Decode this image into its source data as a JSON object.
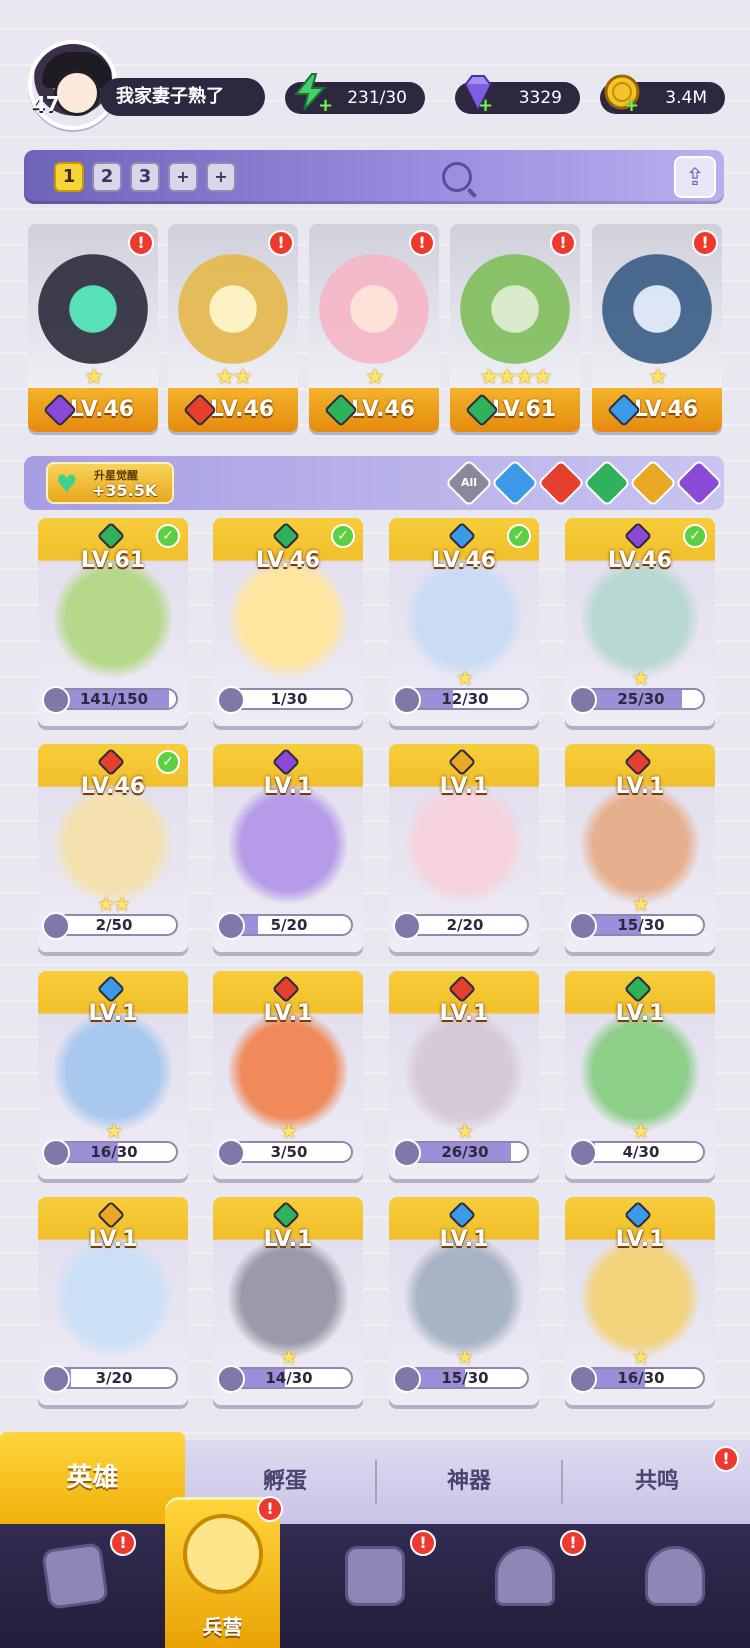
{
  "player": {
    "level": "47",
    "name": "我家妻子熟了"
  },
  "resources": [
    {
      "key": "energy",
      "value": "231/30",
      "icon": "energy-bolt-icon",
      "color": "#45d16a"
    },
    {
      "key": "gems",
      "value": "3329",
      "icon": "gem-icon",
      "color": "#a58cf4"
    },
    {
      "key": "gold",
      "value": "3.4M",
      "icon": "gold-coin-icon",
      "color": "#f2c32b"
    }
  ],
  "teams": {
    "slots": [
      "1",
      "2",
      "3",
      "+",
      "+"
    ],
    "active": "1"
  },
  "lineup": [
    {
      "level": "LV.46",
      "element": "dark",
      "stars": "★",
      "alert": "!"
    },
    {
      "level": "LV.46",
      "element": "fire",
      "stars": "★★",
      "alert": "!"
    },
    {
      "level": "LV.46",
      "element": "wind",
      "stars": "★",
      "alert": "!"
    },
    {
      "level": "LV.61",
      "element": "wind",
      "stars": "★★★★",
      "alert": "!"
    },
    {
      "level": "LV.46",
      "element": "water",
      "stars": "★",
      "alert": "!"
    }
  ],
  "awaken": {
    "label": "升星觉醒",
    "value": "+35.5K"
  },
  "filters": [
    {
      "name": "all",
      "label": "All",
      "color": "#8b879d"
    },
    {
      "name": "water",
      "label": "",
      "color": "#3b9ae8"
    },
    {
      "name": "fire",
      "label": "",
      "color": "#e5402e"
    },
    {
      "name": "wind",
      "label": "",
      "color": "#2fb25a"
    },
    {
      "name": "light",
      "label": "",
      "color": "#e8a824"
    },
    {
      "name": "dark",
      "label": "",
      "color": "#8a4ad6"
    }
  ],
  "element_colors": {
    "dark": "#8a4ad6",
    "fire": "#e5402e",
    "wind": "#2fb25a",
    "water": "#3b9ae8",
    "light": "#e8a824"
  },
  "heroes": [
    {
      "level": "LV.61",
      "element": "wind",
      "shards": "141/150",
      "progress": 0.94,
      "checked": true,
      "stars": ""
    },
    {
      "level": "LV.46",
      "element": "wind",
      "shards": "1/30",
      "progress": 0.03,
      "checked": true,
      "stars": ""
    },
    {
      "level": "LV.46",
      "element": "water",
      "shards": "12/30",
      "progress": 0.4,
      "checked": true,
      "stars": "★"
    },
    {
      "level": "LV.46",
      "element": "dark",
      "shards": "25/30",
      "progress": 0.83,
      "checked": true,
      "stars": "★"
    },
    {
      "level": "LV.46",
      "element": "fire",
      "shards": "2/50",
      "progress": 0.04,
      "checked": true,
      "stars": "★★"
    },
    {
      "level": "LV.1",
      "element": "dark",
      "shards": "5/20",
      "progress": 0.25,
      "checked": false,
      "stars": ""
    },
    {
      "level": "LV.1",
      "element": "light",
      "shards": "2/20",
      "progress": 0.1,
      "checked": false,
      "stars": ""
    },
    {
      "level": "LV.1",
      "element": "fire",
      "shards": "15/30",
      "progress": 0.5,
      "checked": false,
      "stars": "★"
    },
    {
      "level": "LV.1",
      "element": "water",
      "shards": "16/30",
      "progress": 0.53,
      "checked": false,
      "stars": "★"
    },
    {
      "level": "LV.1",
      "element": "fire",
      "shards": "3/50",
      "progress": 0.06,
      "checked": false,
      "stars": "★"
    },
    {
      "level": "LV.1",
      "element": "fire",
      "shards": "26/30",
      "progress": 0.87,
      "checked": false,
      "stars": "★"
    },
    {
      "level": "LV.1",
      "element": "wind",
      "shards": "4/30",
      "progress": 0.13,
      "checked": false,
      "stars": "★"
    },
    {
      "level": "LV.1",
      "element": "light",
      "shards": "3/20",
      "progress": 0.15,
      "checked": false,
      "stars": ""
    },
    {
      "level": "LV.1",
      "element": "wind",
      "shards": "14/30",
      "progress": 0.47,
      "checked": false,
      "stars": "★"
    },
    {
      "level": "LV.1",
      "element": "water",
      "shards": "15/30",
      "progress": 0.5,
      "checked": false,
      "stars": "★"
    },
    {
      "level": "LV.1",
      "element": "water",
      "shards": "16/30",
      "progress": 0.53,
      "checked": false,
      "stars": "★"
    }
  ],
  "tabs": [
    {
      "label": "英雄",
      "active": true,
      "alert": false
    },
    {
      "label": "孵蛋",
      "active": false,
      "alert": false
    },
    {
      "label": "神器",
      "active": false,
      "alert": false
    },
    {
      "label": "共鸣",
      "active": false,
      "alert": true
    }
  ],
  "nav": [
    {
      "name": "cards",
      "icon": "cards-icon",
      "label": "",
      "alert": true
    },
    {
      "name": "barracks",
      "icon": "barracks-icon",
      "label": "兵营",
      "alert": true,
      "active": true
    },
    {
      "name": "map",
      "icon": "map-icon",
      "label": "",
      "alert": true
    },
    {
      "name": "shop",
      "icon": "shop-icon",
      "label": "",
      "alert": true
    },
    {
      "name": "guild",
      "icon": "guild-icon",
      "label": "",
      "alert": false
    }
  ],
  "alert_symbol": "!",
  "check_symbol": "✓",
  "share_symbol": "⇪"
}
